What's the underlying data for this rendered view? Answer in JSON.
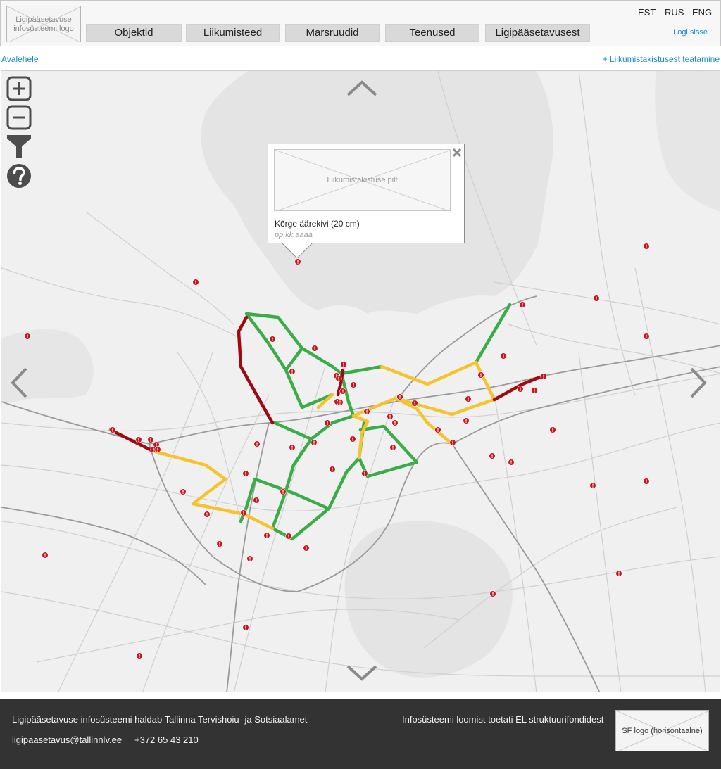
{
  "header": {
    "logo_text": "Ligipääsetavuse infosüsteemi logo",
    "nav": [
      "Objektid",
      "Liikumisteed",
      "Marsruudid",
      "Teenused",
      "Ligipääsetavusest"
    ],
    "languages": [
      "EST",
      "RUS",
      "ENG"
    ],
    "login": "Logi sisse"
  },
  "breadcrumb": "Avalehele",
  "report_link": "+ Liikumistakistusest teatamine",
  "map": {
    "controls": [
      "zoom-in-icon",
      "zoom-out-icon",
      "filter-icon",
      "help-icon"
    ],
    "pan_arrows": [
      "chevron-up-icon",
      "chevron-down-icon",
      "chevron-left-icon",
      "chevron-right-icon"
    ],
    "route_colors": {
      "good": "#3aac48",
      "medium": "#f5c32c",
      "bad": "#9e0a12"
    },
    "marker_color": "#c8141e"
  },
  "popup": {
    "image_label": "Liikumistakistuse pilt",
    "title": "Kõrge äärekivi (20 cm)",
    "date": "pp.kk.aaaa"
  },
  "footer": {
    "maintainer": "Ligipääsetavuse infosüsteemi haldab Tallinna Tervishoiu- ja Sotsiaalamet",
    "email": "ligipaasetavus@tallinnlv.ee",
    "phone": "+372 65 43 210",
    "funding": "Infosüsteemi loomist toetati EL struktuurifondidest",
    "sf_logo": "SF logo (horisontaalne)"
  }
}
